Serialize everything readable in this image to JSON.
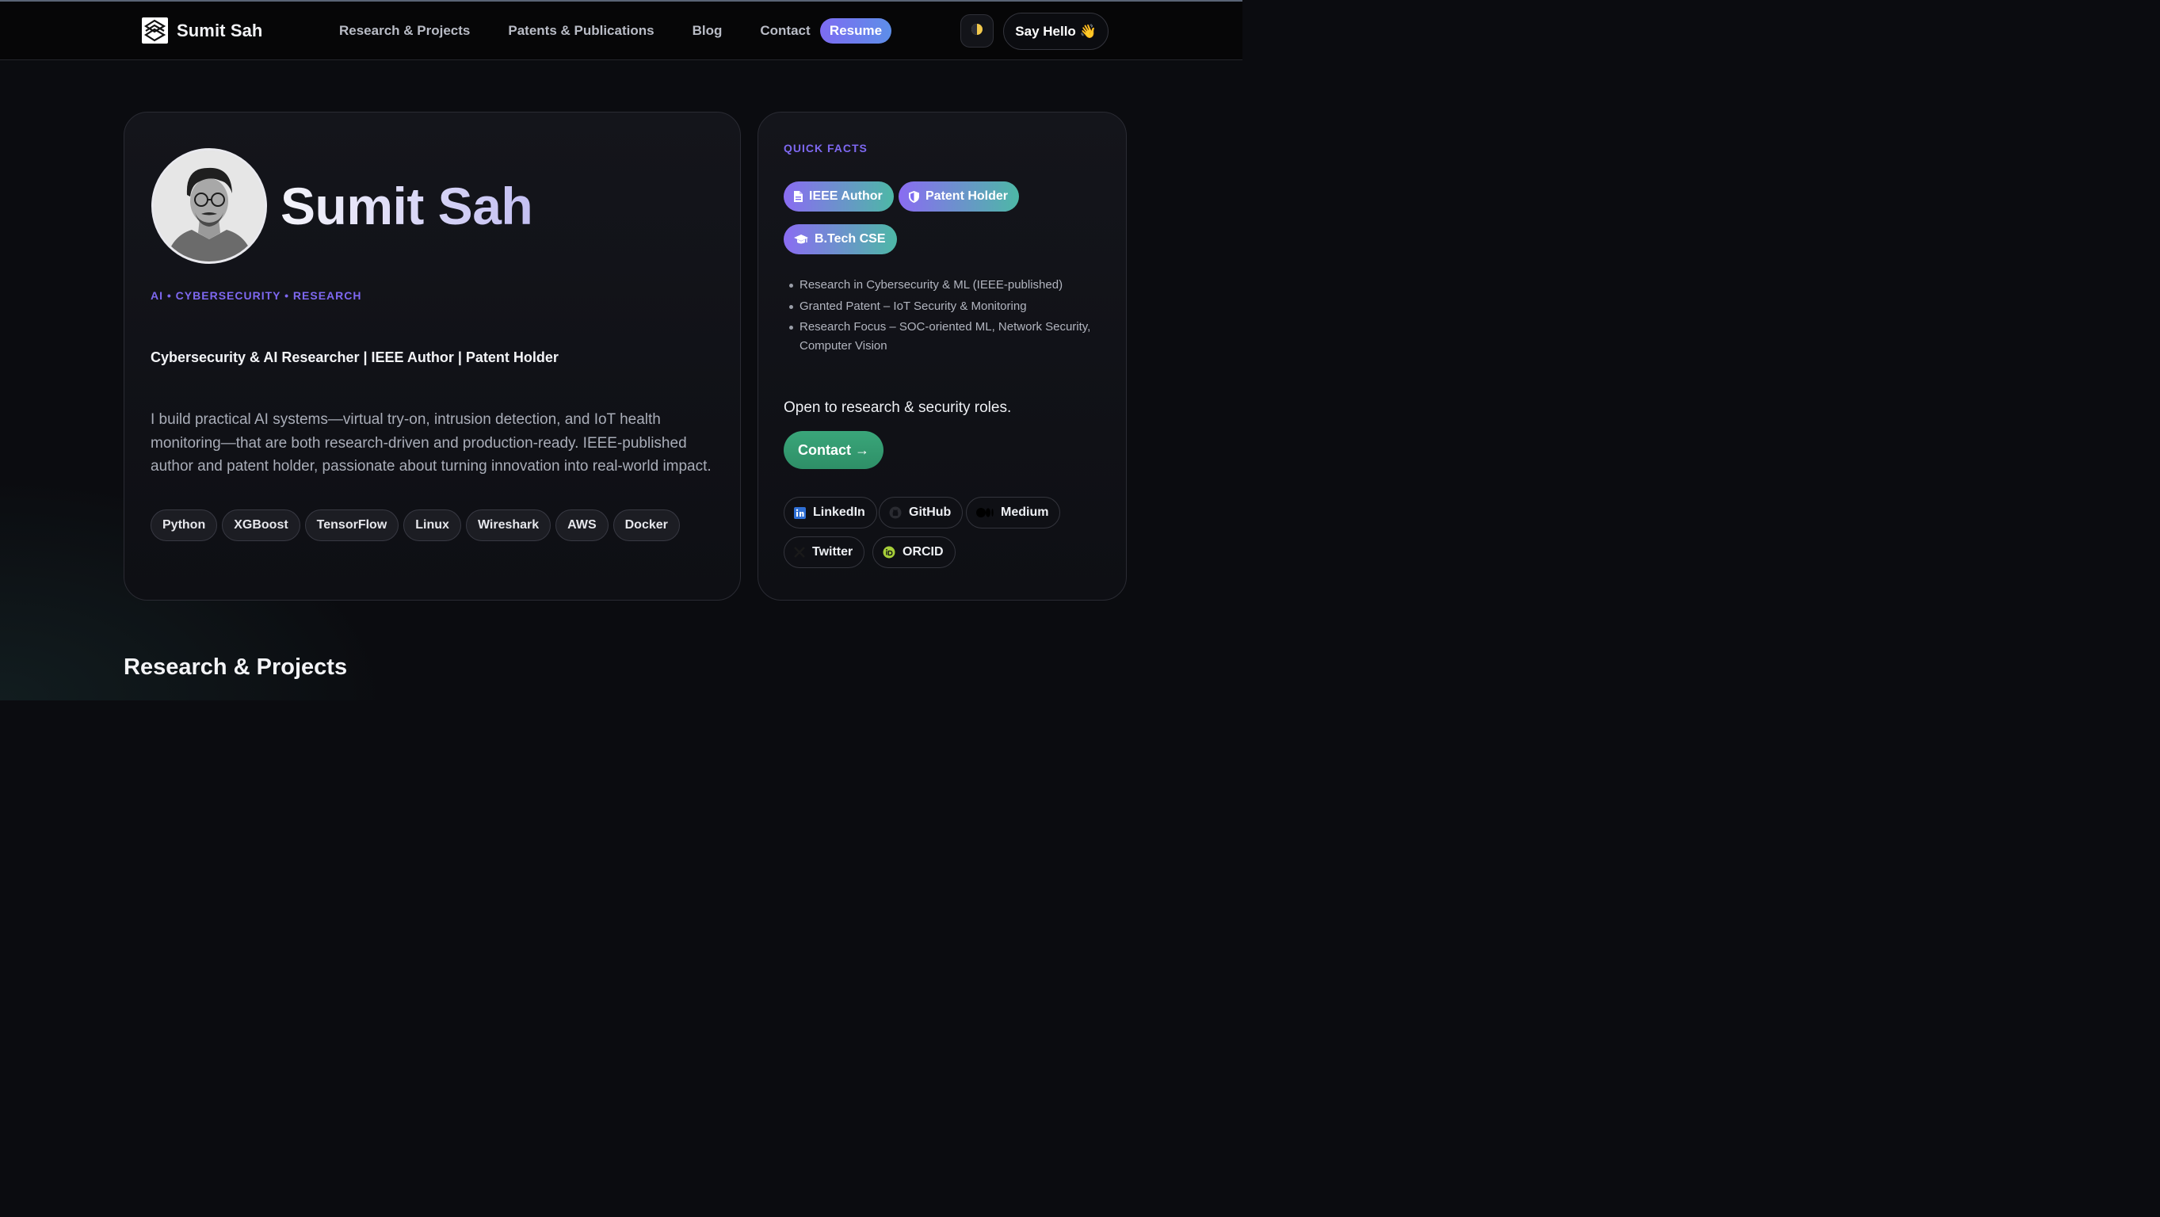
{
  "nav": {
    "brand_name": "Sumit Sah",
    "links": [
      "Research & Projects",
      "Patents & Publications",
      "Blog",
      "Contact"
    ],
    "resume_label": "Resume",
    "say_hello_label": "Say Hello 👋",
    "theme_icon": "half-moon-icon"
  },
  "hero": {
    "name": "Sumit Sah",
    "eyebrow": "AI • CYBERSECURITY • RESEARCH",
    "headline": "Cybersecurity & AI Researcher | IEEE Author | Patent Holder",
    "bio": "I build practical AI systems—virtual try-on, intrusion detection, and IoT health monitoring—that are both research-driven and production-ready. IEEE-published author and patent holder, passionate about turning innovation into real-world impact.",
    "skills": [
      "Python",
      "XGBoost",
      "TensorFlow",
      "Linux",
      "Wireshark",
      "AWS",
      "Docker"
    ]
  },
  "facts": {
    "title": "QUICK FACTS",
    "badges": [
      {
        "label": "IEEE Author",
        "icon": "document-icon"
      },
      {
        "label": "Patent Holder",
        "icon": "shield-icon"
      },
      {
        "label": "B.Tech CSE",
        "icon": "graduation-cap-icon"
      }
    ],
    "items": [
      "Research in Cybersecurity & ML (IEEE-published)",
      "Granted Patent – IoT Security & Monitoring",
      "Research Focus – SOC-oriented ML, Network Security, Computer Vision"
    ],
    "open_text": "Open to research & security roles.",
    "contact_label": "Contact →",
    "socials": [
      {
        "label": "LinkedIn",
        "icon": "linkedin-icon"
      },
      {
        "label": "GitHub",
        "icon": "github-icon"
      },
      {
        "label": "Medium",
        "icon": "medium-icon"
      },
      {
        "label": "Twitter",
        "icon": "x-icon"
      },
      {
        "label": "ORCID",
        "icon": "orcid-icon"
      }
    ]
  },
  "sections": {
    "next_title": "Research & Projects"
  },
  "colors": {
    "accent_purple": "#7e68f0",
    "contact_green": "#3aa67a",
    "background": "#0b0c10"
  }
}
